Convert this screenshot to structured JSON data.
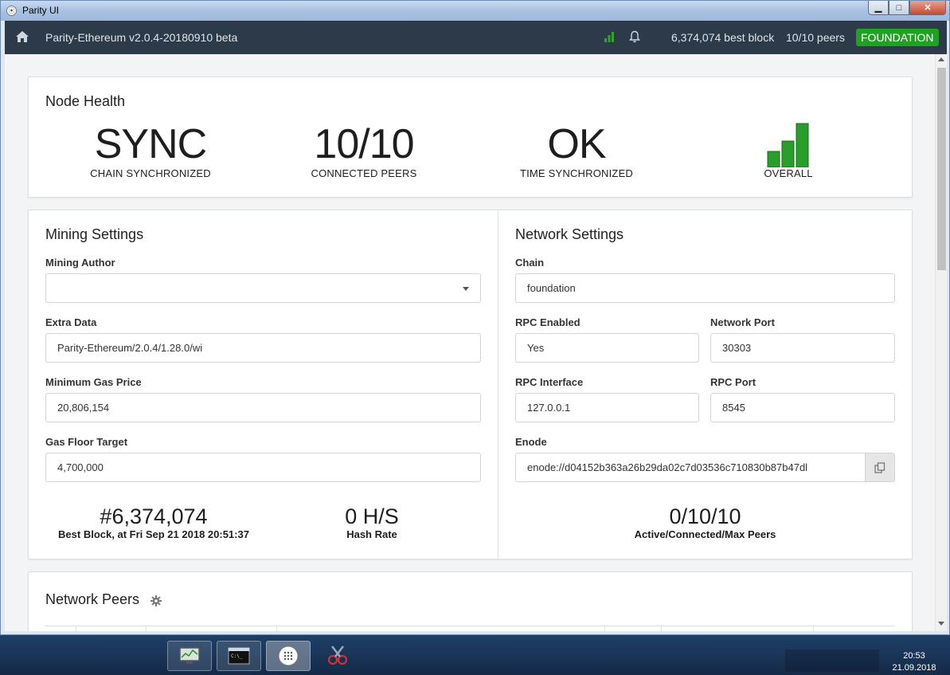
{
  "window": {
    "title": "Parity UI"
  },
  "appbar": {
    "version": "Parity-Ethereum v2.0.4-20180910 beta",
    "best_block": "6,374,074 best block",
    "peers": "10/10 peers",
    "chain_badge": "FOUNDATION",
    "badge_color": "#21a121"
  },
  "node_health": {
    "title": "Node Health",
    "sync": {
      "value": "SYNC",
      "label": "CHAIN SYNCHRONIZED"
    },
    "peers": {
      "value": "10/10",
      "label": "CONNECTED PEERS"
    },
    "time": {
      "value": "OK",
      "label": "TIME SYNCHRONIZED"
    },
    "overall": {
      "label": "OVERALL",
      "level": 3,
      "max_level": 3
    }
  },
  "mining": {
    "title": "Mining Settings",
    "author_label": "Mining Author",
    "author_value": "",
    "extra_label": "Extra Data",
    "extra_value": "Parity-Ethereum/2.0.4/1.28.0/wi",
    "gas_price_label": "Minimum Gas Price",
    "gas_price_value": "20,806,154",
    "gas_floor_label": "Gas Floor Target",
    "gas_floor_value": "4,700,000",
    "best_block_value": "#6,374,074",
    "best_block_label": "Best Block, at Fri Sep 21 2018 20:51:37",
    "hash_rate_value": "0 H/S",
    "hash_rate_label": "Hash Rate"
  },
  "network": {
    "title": "Network Settings",
    "chain_label": "Chain",
    "chain_value": "foundation",
    "rpc_enabled_label": "RPC Enabled",
    "rpc_enabled_value": "Yes",
    "network_port_label": "Network Port",
    "network_port_value": "30303",
    "rpc_interface_label": "RPC Interface",
    "rpc_interface_value": "127.0.0.1",
    "rpc_port_label": "RPC Port",
    "rpc_port_value": "8545",
    "enode_label": "Enode",
    "enode_value": "enode://d04152b363a26b29da02c7d03536c710830b87b47dl",
    "peers_value": "0/10/10",
    "peers_label": "Active/Connected/Max Peers"
  },
  "peers_card": {
    "title": "Network Peers"
  },
  "taskbar": {
    "time": "20:53",
    "date": "21.09.2018"
  }
}
